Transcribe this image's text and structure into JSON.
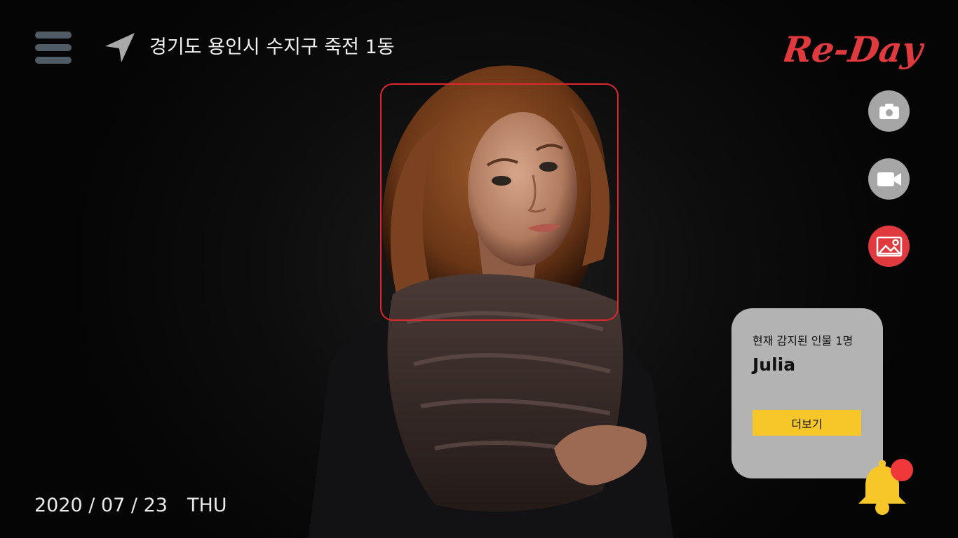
{
  "header": {
    "menu_icon": "hamburger-menu-icon",
    "location_icon": "navigation-arrow-icon",
    "location": "경기도 용인시 수지구 죽전 1동",
    "logo_text": "Re-Day"
  },
  "actions": [
    {
      "name": "camera",
      "icon": "camera-icon"
    },
    {
      "name": "video",
      "icon": "video-camera-icon"
    },
    {
      "name": "gallery",
      "icon": "image-gallery-icon"
    }
  ],
  "detection": {
    "title": "현재 감지된 인물 1명",
    "person_name": "Julia",
    "more_label": "더보기"
  },
  "notification": {
    "icon": "bell-icon"
  },
  "footer": {
    "date": "2020 / 07 / 23",
    "weekday": "THU"
  },
  "colors": {
    "accent_red": "#e0262d",
    "logo_red": "#e03a3f",
    "button_gray": "#a6a6a6",
    "card_gray": "#b3b3b3",
    "button_yellow": "#f7c72a",
    "bell_yellow": "#f7c72a",
    "badge_red": "#f0373a"
  }
}
